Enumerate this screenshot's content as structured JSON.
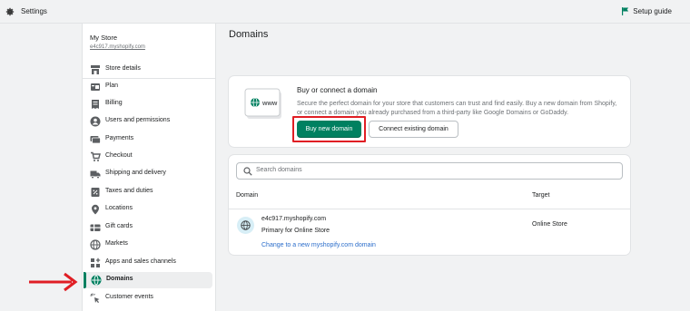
{
  "topbar": {
    "title": "Settings",
    "setup_guide": "Setup guide",
    "icon": "gear-icon",
    "setup_icon": "flag-icon"
  },
  "store": {
    "name": "My Store",
    "domain": "e4c917.myshopify.com"
  },
  "sidebar": {
    "items": [
      {
        "label": "Store details",
        "icon": "store-icon"
      },
      {
        "label": "Plan",
        "icon": "plan-icon"
      },
      {
        "label": "Billing",
        "icon": "billing-icon"
      },
      {
        "label": "Users and permissions",
        "icon": "user-icon"
      },
      {
        "label": "Payments",
        "icon": "payments-icon"
      },
      {
        "label": "Checkout",
        "icon": "cart-icon"
      },
      {
        "label": "Shipping and delivery",
        "icon": "truck-icon"
      },
      {
        "label": "Taxes and duties",
        "icon": "taxes-icon"
      },
      {
        "label": "Locations",
        "icon": "location-icon"
      },
      {
        "label": "Gift cards",
        "icon": "gift-card-icon"
      },
      {
        "label": "Markets",
        "icon": "globe-icon"
      },
      {
        "label": "Apps and sales channels",
        "icon": "apps-icon"
      },
      {
        "label": "Domains",
        "icon": "domains-globe-icon",
        "active": true
      },
      {
        "label": "Customer events",
        "icon": "cursor-sparkle-icon"
      }
    ]
  },
  "main": {
    "title": "Domains",
    "connect_card": {
      "title": "Buy or connect a domain",
      "illustration_text": "www",
      "description": "Secure the perfect domain for your store that customers can trust and find easily. Buy a new domain from Shopify, or connect a domain you already purchased from a third-party like Google Domains or GoDaddy.",
      "buy_button": "Buy new domain",
      "connect_button": "Connect existing domain"
    },
    "domains_card": {
      "search_placeholder": "Search domains",
      "col_domain": "Domain",
      "col_target": "Target",
      "rows": [
        {
          "domain": "e4c917.myshopify.com",
          "subtitle": "Primary for Online Store",
          "link": "Change to a new myshopify.com domain",
          "target": "Online Store"
        }
      ]
    }
  },
  "colors": {
    "accent": "#008060",
    "highlight": "#e01e24",
    "link": "#2c6ecb"
  }
}
